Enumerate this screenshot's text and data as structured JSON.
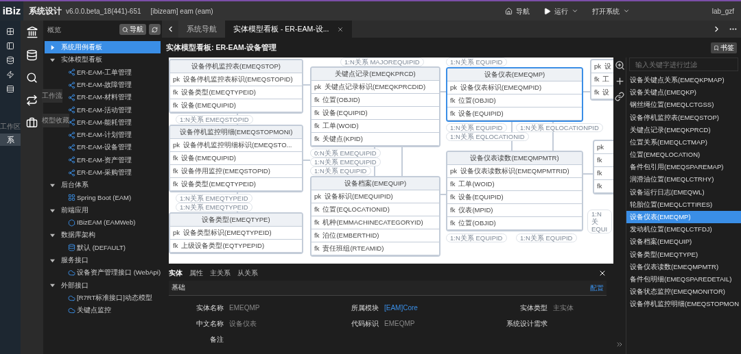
{
  "header": {
    "logo": "iBiz",
    "title": "系统设计",
    "version": "v6.0.0.beta_18(441)-651",
    "project": "[ibizeam] eam (eam)",
    "menu": [
      {
        "label": "导航",
        "kind": "home"
      },
      {
        "label": "运行",
        "kind": "run"
      },
      {
        "label": "打开系统",
        "kind": "dropdown"
      }
    ],
    "user": "lab_gzf"
  },
  "rail": {
    "workspace_label": "工作区",
    "items": [
      {
        "label": "系",
        "selected": true
      }
    ]
  },
  "nav_tooltips": [
    "工作流",
    "模型收藏"
  ],
  "tree": {
    "title": "概览",
    "nav_button": "导航",
    "items": [
      {
        "label": "系统用例看板",
        "selected": true,
        "expanded": false
      },
      {
        "label": "实体模型看板",
        "selected": false,
        "expanded": true,
        "children": [
          {
            "label": "ER-EAM-工单管理",
            "kind": "er",
            "selected": false
          },
          {
            "label": "ER-EAM-故障管理",
            "kind": "er",
            "selected": false
          },
          {
            "label": "ER-EAM-材料管理",
            "kind": "er",
            "selected": false
          },
          {
            "label": "ER-EAM-活动管理",
            "kind": "er",
            "selected": false
          },
          {
            "label": "ER-EAM-能耗管理",
            "kind": "er",
            "selected": false
          },
          {
            "label": "ER-EAM-计划管理",
            "kind": "er",
            "selected": false
          },
          {
            "label": "ER-EAM-设备管理",
            "kind": "er",
            "selected": false
          },
          {
            "label": "ER-EAM-资产管理",
            "kind": "er",
            "selected": false
          },
          {
            "label": "ER-EAM-采购管理",
            "kind": "er",
            "selected": false
          }
        ]
      },
      {
        "label": "后台体系",
        "selected": false,
        "expanded": true,
        "children": [
          {
            "label": "Spring Boot (EAM)",
            "kind": "backend",
            "selected": false
          }
        ]
      },
      {
        "label": "前端应用",
        "selected": false,
        "expanded": true,
        "children": [
          {
            "label": "IBizEAM (EAMWeb)",
            "kind": "frontend",
            "selected": false
          }
        ]
      },
      {
        "label": "数据库架构",
        "selected": false,
        "expanded": true,
        "children": [
          {
            "label": "默认 (DEFAULT)",
            "kind": "database",
            "selected": false
          }
        ]
      },
      {
        "label": "服务接口",
        "selected": false,
        "expanded": true,
        "children": [
          {
            "label": "设备资产管理接口 (WebApi)",
            "kind": "api",
            "selected": false
          }
        ]
      },
      {
        "label": "外部接口",
        "selected": false,
        "expanded": true,
        "children": [
          {
            "label": "[R7RT标准接口]动态模型",
            "kind": "api",
            "selected": false
          },
          {
            "label": "关键点监控",
            "kind": "api",
            "selected": false
          }
        ]
      }
    ]
  },
  "tabs": [
    {
      "label": "系统导航",
      "selected": false
    },
    {
      "label": "实体模型看板 - ER-EAM-设...",
      "selected": true
    }
  ],
  "board": {
    "title": "实体模型看板: ER-EAM-设备管理",
    "bookmark": "书签",
    "entities": [
      {
        "title": "设备停机监控表(EMEQSTOP)",
        "selected": false,
        "fields": [
          {
            "key": "pk",
            "name": "设备停机监控表标识(EMEQSTOPID)"
          },
          {
            "key": "fk",
            "name": "设备类型(EMEQTYPEID)"
          },
          {
            "key": "fk",
            "name": "设备(EMEQUIPID)"
          }
        ]
      },
      {
        "title": "关键点记录(EMEQKPRCD)",
        "selected": false,
        "fields": [
          {
            "key": "pk",
            "name": "关键点记录标识(EMEQKPRCDID)"
          },
          {
            "key": "fk",
            "name": "位置(OBJID)"
          },
          {
            "key": "fk",
            "name": "设备(EQUIPID)"
          },
          {
            "key": "fk",
            "name": "工单(WOID)"
          },
          {
            "key": "fk",
            "name": "关键点(KPID)"
          }
        ]
      },
      {
        "title": "设备仪表(EMEQMP)",
        "selected": true,
        "fields": [
          {
            "key": "pk",
            "name": "设备仪表标识(EMEQMPID)"
          },
          {
            "key": "fk",
            "name": "位置(OBJID)"
          },
          {
            "key": "fk",
            "name": "设备(EQUIPID)"
          }
        ]
      },
      {
        "selected": false,
        "fields": [
          {
            "key": "pk",
            "name": "设"
          },
          {
            "key": "fk",
            "name": "工"
          },
          {
            "key": "fk",
            "name": "设"
          }
        ]
      },
      {
        "title": "设备停机监控明细(EMEQSTOPMONI)",
        "selected": false,
        "fields": [
          {
            "key": "pk",
            "name": "设备停机监控明细标识(EMEQSTO..."
          },
          {
            "key": "fk",
            "name": "设备(EMEQUIPID)"
          },
          {
            "key": "fk",
            "name": "设备停用监控(EMEQSTOPID)"
          },
          {
            "key": "fk",
            "name": "设备类型(EMEQTYPEID)"
          }
        ]
      },
      {
        "title": "设备类型(EMEQTYPE)",
        "selected": false,
        "fields": [
          {
            "key": "pk",
            "name": "设备类型标识(EMEQTYPEID)"
          },
          {
            "key": "fk",
            "name": "上级设备类型(EQTYPEPID)"
          }
        ]
      },
      {
        "title": "设备档案(EMEQUIP)",
        "selected": false,
        "fields": [
          {
            "key": "pk",
            "name": "设备标识(EMEQUIPID)"
          },
          {
            "key": "fk",
            "name": "位置(EQLOCATIONID)"
          },
          {
            "key": "fk",
            "name": "机种(EMMACHINECATEGORYID)"
          },
          {
            "key": "fk",
            "name": "泊位(EMBERTHID)"
          },
          {
            "key": "fk",
            "name": "责任班组(RTEAMID)"
          }
        ]
      },
      {
        "title": "设备仪表读数(EMEQMPMTR)",
        "selected": false,
        "fields": [
          {
            "key": "pk",
            "name": "设备仪表读数标识(EMEQMPMTRID)"
          },
          {
            "key": "fk",
            "name": "工单(WOID)"
          },
          {
            "key": "fk",
            "name": "设备(EQUIPID)"
          },
          {
            "key": "fk",
            "name": "仪表(MPID)"
          },
          {
            "key": "fk",
            "name": "位置(OBJID)"
          }
        ]
      },
      {
        "selected": false,
        "fields": [
          {
            "key": "pk"
          },
          {
            "key": "fk"
          },
          {
            "key": "fk"
          },
          {
            "key": "fk"
          }
        ]
      }
    ],
    "relations": [
      "1:N关系 MAJOREQUIPID",
      "1:N关系 EQUIPID",
      "1:N关系 EMEQSTOPID",
      "1:N关系 EQUIPID",
      "1:N关系 EQLOCATIONPID",
      "1:N关系 EQLOCATIONID",
      "0:N关系 EMEQUIPID",
      "1:N关系 EMEQUIPID",
      "1:N关系 EQUIPID",
      "1:N关系 EMEQTYPEID",
      "1:N关系 EMEQTYPEID",
      "1:N关 EQUI",
      "1:N关系 EQUIPID",
      "1:N关系 EQUIPID"
    ]
  },
  "entity_list": {
    "placeholder": "输入关键字进行过滤",
    "items": [
      {
        "label": "设备关键点关系(EMEQKPMAP)",
        "selected": false
      },
      {
        "label": "设备关键点(EMEQKP)",
        "selected": false
      },
      {
        "label": "钢丝绳位置(EMEQLCTGSS)",
        "selected": false
      },
      {
        "label": "设备停机监控表(EMEQSTOP)",
        "selected": false
      },
      {
        "label": "关键点记录(EMEQKPRCD)",
        "selected": false
      },
      {
        "label": "位置关系(EMEQLCTMAP)",
        "selected": false
      },
      {
        "label": "位置(EMEQLOCATION)",
        "selected": false
      },
      {
        "label": "备件包引用(EMEQSPAREMAP)",
        "selected": false
      },
      {
        "label": "润滑油位置(EMEQLCTRHY)",
        "selected": false
      },
      {
        "label": "设备运行日志(EMEQWL)",
        "selected": false
      },
      {
        "label": "轮胎位置(EMEQLCTTIRES)",
        "selected": false
      },
      {
        "label": "设备仪表(EMEQMP)",
        "selected": true
      },
      {
        "label": "发动机位置(EMEQLCTFDJ)",
        "selected": false
      },
      {
        "label": "设备档案(EMEQUIP)",
        "selected": false
      },
      {
        "label": "设备类型(EMEQTYPE)",
        "selected": false
      },
      {
        "label": "设备仪表读数(EMEQMPMTR)",
        "selected": false
      },
      {
        "label": "备件包明细(EMEQSPAREDETAIL)",
        "selected": false
      },
      {
        "label": "设备状态监控(EMEQMONITOR)",
        "selected": false
      },
      {
        "label": "设备停机监控明细(EMEQSTOPMON",
        "selected": false
      }
    ]
  },
  "details": {
    "tabs": [
      {
        "label": "实体",
        "selected": true
      },
      {
        "label": "属性",
        "selected": false
      },
      {
        "label": "主关系",
        "selected": false
      },
      {
        "label": "从关系",
        "selected": false
      }
    ],
    "section": "基础",
    "config": "配置",
    "fields": [
      {
        "label": "实体名称",
        "value": "EMEQMP"
      },
      {
        "label": "所属模块",
        "value": "[EAM]Core",
        "kind": "link"
      },
      {
        "label": "实体类型",
        "value": "主实体"
      },
      {
        "label": "中文名称",
        "value": "设备仪表"
      },
      {
        "label": "代码标识",
        "value": "EMEQMP"
      },
      {
        "label": "系统设计需求"
      },
      {
        "label": "备注"
      }
    ]
  }
}
